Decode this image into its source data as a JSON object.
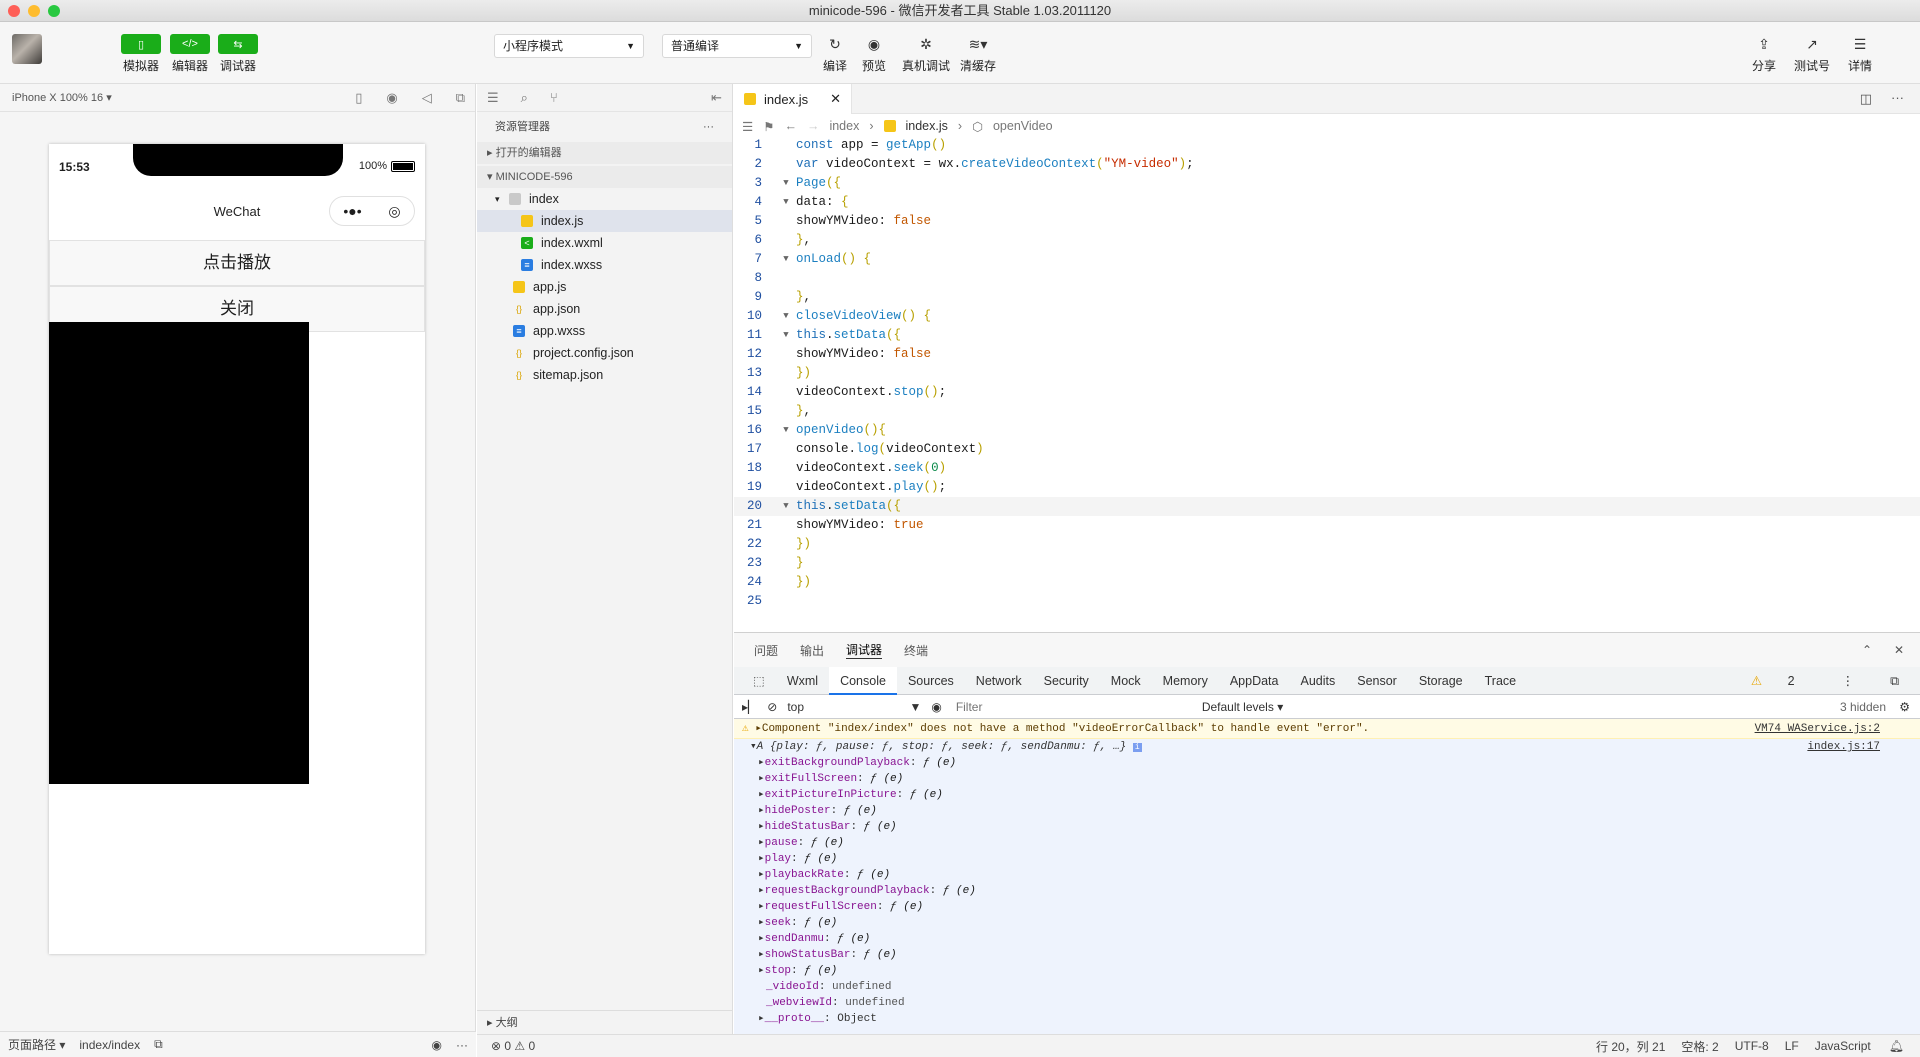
{
  "window": {
    "title": "minicode-596 - 微信开发者工具 Stable 1.03.2011120"
  },
  "toolbar": {
    "simulator": "模拟器",
    "editor": "编辑器",
    "debugger": "调试器",
    "mode_select": "小程序模式",
    "compile_select": "普通编译",
    "compile": "编译",
    "preview": "预览",
    "real_debug": "真机调试",
    "clear_cache": "清缓存",
    "share": "分享",
    "test_account": "测试号",
    "details": "详情"
  },
  "simulator": {
    "device": "iPhone X 100% 16",
    "time": "15:53",
    "battery": "100%",
    "nav_title": "WeChat",
    "play_button": "点击播放",
    "close_button": "关闭",
    "footer_path_label": "页面路径",
    "footer_path": "index/index"
  },
  "explorer": {
    "title": "资源管理器",
    "open_editors": "打开的编辑器",
    "project": "MINICODE-596",
    "items": [
      {
        "name": "index",
        "type": "folder"
      },
      {
        "name": "index.js",
        "type": "js"
      },
      {
        "name": "index.wxml",
        "type": "wxml"
      },
      {
        "name": "index.wxss",
        "type": "wxss"
      },
      {
        "name": "app.js",
        "type": "js"
      },
      {
        "name": "app.json",
        "type": "json"
      },
      {
        "name": "app.wxss",
        "type": "wxss"
      },
      {
        "name": "project.config.json",
        "type": "json"
      },
      {
        "name": "sitemap.json",
        "type": "json"
      }
    ],
    "outline": "大纲"
  },
  "editor": {
    "tab": "index.js",
    "breadcrumb": [
      "index",
      "index.js",
      "openVideo"
    ]
  },
  "devtools": {
    "top_tabs": [
      "问题",
      "输出",
      "调试器",
      "终端"
    ],
    "tabs": [
      "Wxml",
      "Console",
      "Sources",
      "Network",
      "Security",
      "Mock",
      "Memory",
      "AppData",
      "Audits",
      "Sensor",
      "Storage",
      "Trace"
    ],
    "warning_count": "2",
    "context": "top",
    "filter_placeholder": "Filter",
    "levels": "Default levels",
    "hidden": "3 hidden",
    "warning_text": "Component \"index/index\" does not have a method \"videoErrorCallback\" to handle event \"error\".",
    "warning_src": "VM74 WAService.js:2",
    "object_summary": "A {play: ƒ, pause: ƒ, stop: ƒ, seek: ƒ, sendDanmu: ƒ, …}",
    "object_src": "index.js:17",
    "props": [
      {
        "k": "exitBackgroundPlayback",
        "v": "ƒ (e)"
      },
      {
        "k": "exitFullScreen",
        "v": "ƒ (e)"
      },
      {
        "k": "exitPictureInPicture",
        "v": "ƒ (e)"
      },
      {
        "k": "hidePoster",
        "v": "ƒ (e)"
      },
      {
        "k": "hideStatusBar",
        "v": "ƒ (e)"
      },
      {
        "k": "pause",
        "v": "ƒ (e)"
      },
      {
        "k": "play",
        "v": "ƒ (e)"
      },
      {
        "k": "playbackRate",
        "v": "ƒ (e)"
      },
      {
        "k": "requestBackgroundPlayback",
        "v": "ƒ (e)"
      },
      {
        "k": "requestFullScreen",
        "v": "ƒ (e)"
      },
      {
        "k": "seek",
        "v": "ƒ (e)"
      },
      {
        "k": "sendDanmu",
        "v": "ƒ (e)"
      },
      {
        "k": "showStatusBar",
        "v": "ƒ (e)"
      },
      {
        "k": "stop",
        "v": "ƒ (e)"
      },
      {
        "k": "_videoId",
        "v": "undefined"
      },
      {
        "k": "_webviewId",
        "v": "undefined"
      },
      {
        "k": "__proto__",
        "v": "Object"
      }
    ]
  },
  "status": {
    "errors": "0",
    "warnings": "0",
    "position": "行 20，列 21",
    "spaces": "空格: 2",
    "encoding": "UTF-8",
    "eol": "LF",
    "language": "JavaScript"
  },
  "colors": {
    "accent_green": "#1aad19",
    "chrome_blue": "#1a73e8"
  }
}
